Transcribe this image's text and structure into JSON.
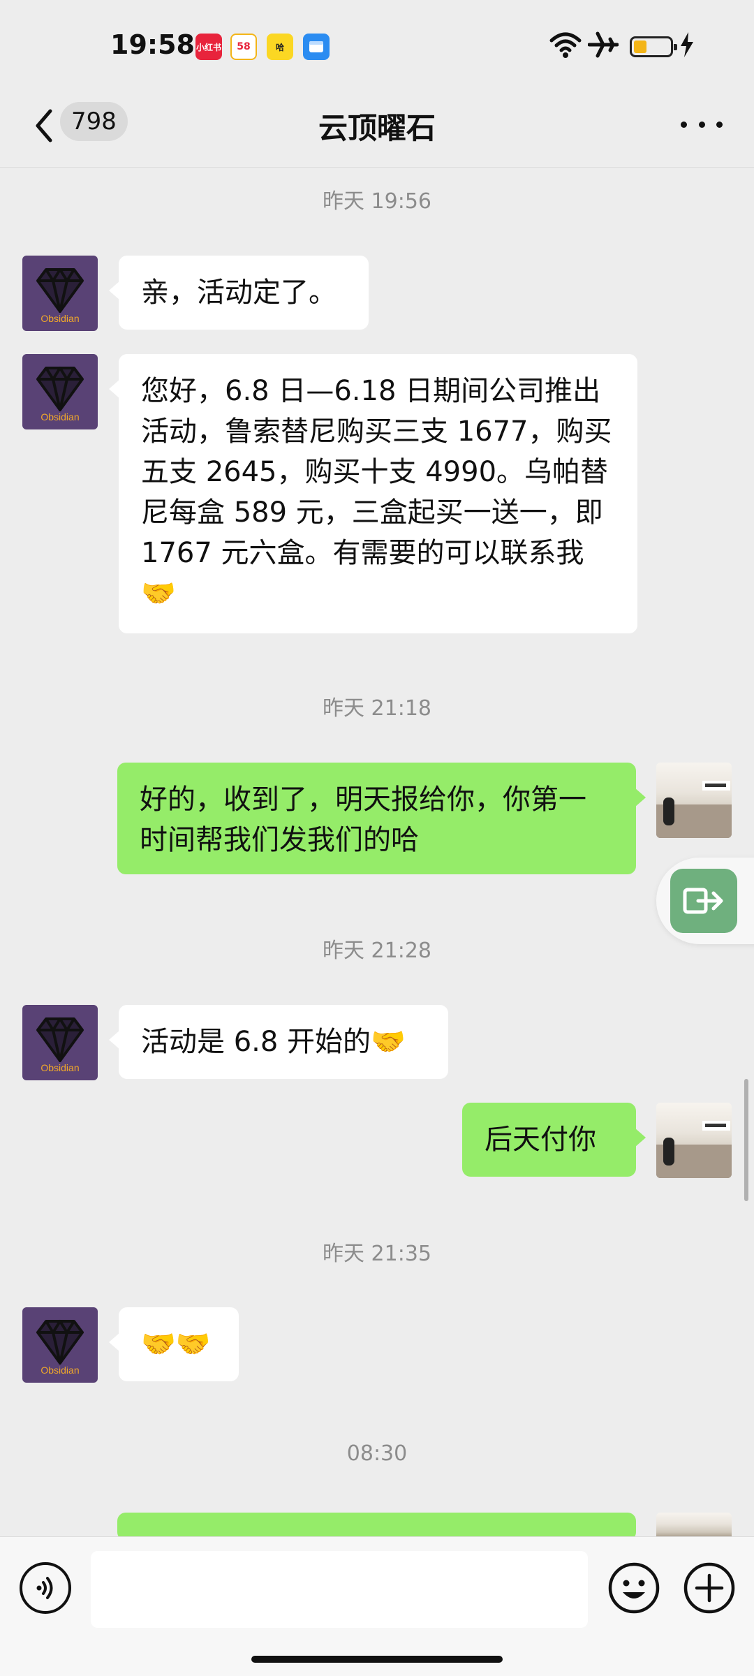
{
  "status_bar": {
    "time": "19:58",
    "apps": [
      "小红书",
      "58",
      "哈",
      ""
    ],
    "icons": [
      "wifi-icon",
      "airplane-icon",
      "battery-icon",
      "charging-icon"
    ]
  },
  "header": {
    "back_icon": "chevron-left-icon",
    "unread_count": "798",
    "title": "云顶曜石",
    "more_icon": "more-dots-icon"
  },
  "avatars": {
    "contact_label": "Obsidian"
  },
  "messages": [
    {
      "timestamp": "昨天 19:56"
    },
    {
      "text": "亲，活动定了。"
    },
    {
      "text": "您好，6.8 日—6.18 日期间公司推出活动，鲁索替尼购买三支 1677，购买五支 2645，购买十支 4990。乌帕替尼每盒 589 元，三盒起买一送一，即 1767 元六盒。有需要的可以联系我🤝"
    },
    {
      "timestamp": "昨天 21:18"
    },
    {
      "text": "好的，收到了，明天报给你，你第一时间帮我们发我们的哈"
    },
    {
      "timestamp": "昨天 21:28"
    },
    {
      "text": "活动是 6.8 开始的🤝"
    },
    {
      "text": "后天付你"
    },
    {
      "timestamp": "昨天 21:35"
    },
    {
      "text": "🤝🤝"
    },
    {
      "timestamp": "08:30"
    }
  ],
  "input_bar": {
    "voice_icon": "voice-icon",
    "input_value": "",
    "emoji_icon": "emoji-icon",
    "plus_icon": "plus-icon"
  },
  "colors": {
    "background": "#ededed",
    "outgoing_bubble": "#95ec69",
    "incoming_bubble": "#ffffff",
    "avatar_bg": "#594275"
  }
}
